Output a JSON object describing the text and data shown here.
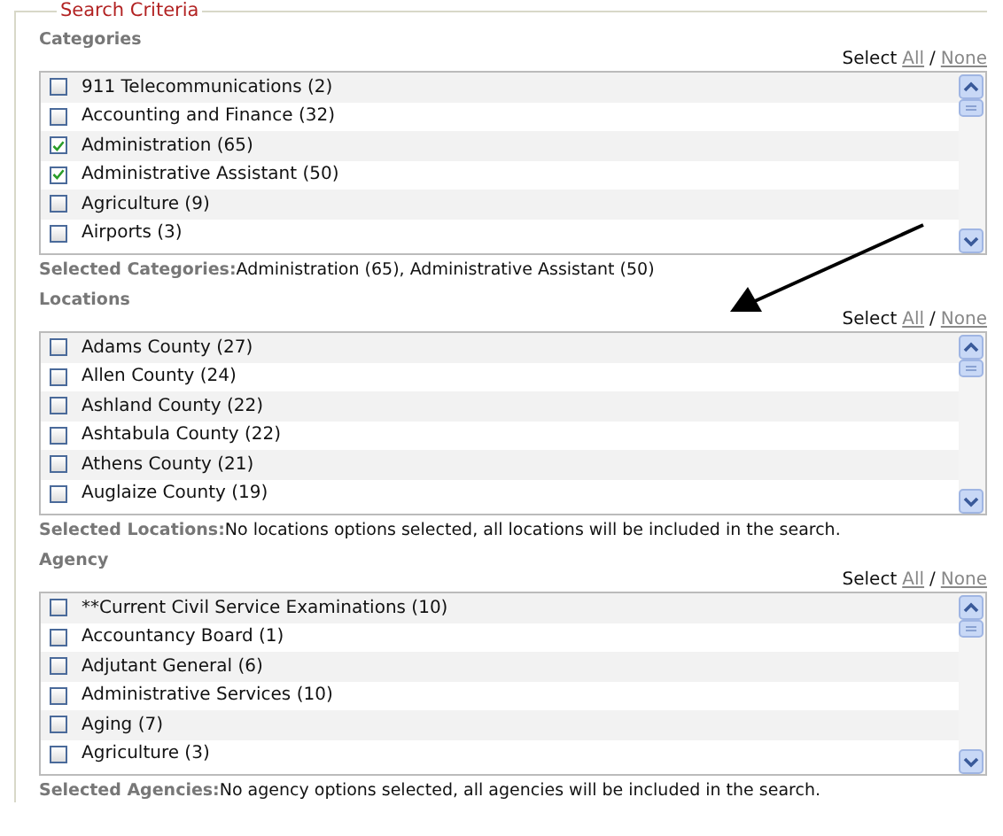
{
  "legend": "Search Criteria",
  "sections": [
    {
      "title": "Categories",
      "select_label": "Select",
      "all_link": "All",
      "separator": "/",
      "none_link": "None",
      "items": [
        {
          "label": "911 Telecommunications (2)",
          "checked": false
        },
        {
          "label": "Accounting and Finance (32)",
          "checked": false
        },
        {
          "label": "Administration (65)",
          "checked": true
        },
        {
          "label": "Administrative Assistant (50)",
          "checked": true
        },
        {
          "label": "Agriculture (9)",
          "checked": false
        },
        {
          "label": "Airports (3)",
          "checked": false
        }
      ],
      "selected_label": "Selected Categories:",
      "selected_text": "Administration (65), Administrative Assistant (50)"
    },
    {
      "title": "Locations",
      "select_label": "Select",
      "all_link": "All",
      "separator": "/",
      "none_link": "None",
      "items": [
        {
          "label": "Adams County (27)",
          "checked": false
        },
        {
          "label": "Allen County (24)",
          "checked": false
        },
        {
          "label": "Ashland County (22)",
          "checked": false
        },
        {
          "label": "Ashtabula County (22)",
          "checked": false
        },
        {
          "label": "Athens County (21)",
          "checked": false
        },
        {
          "label": "Auglaize County (19)",
          "checked": false
        }
      ],
      "selected_label": "Selected Locations:",
      "selected_text": "No locations options selected, all locations will be included in the search."
    },
    {
      "title": "Agency",
      "select_label": "Select",
      "all_link": "All",
      "separator": "/",
      "none_link": "None",
      "items": [
        {
          "label": "**Current Civil Service Examinations (10)",
          "checked": false
        },
        {
          "label": "Accountancy Board (1)",
          "checked": false
        },
        {
          "label": "Adjutant General (6)",
          "checked": false
        },
        {
          "label": "Administrative Services (10)",
          "checked": false
        },
        {
          "label": "Aging (7)",
          "checked": false
        },
        {
          "label": "Agriculture (3)",
          "checked": false
        }
      ],
      "selected_label": "Selected Agencies:",
      "selected_text": "No agency options selected, all agencies will be included in the search."
    }
  ]
}
